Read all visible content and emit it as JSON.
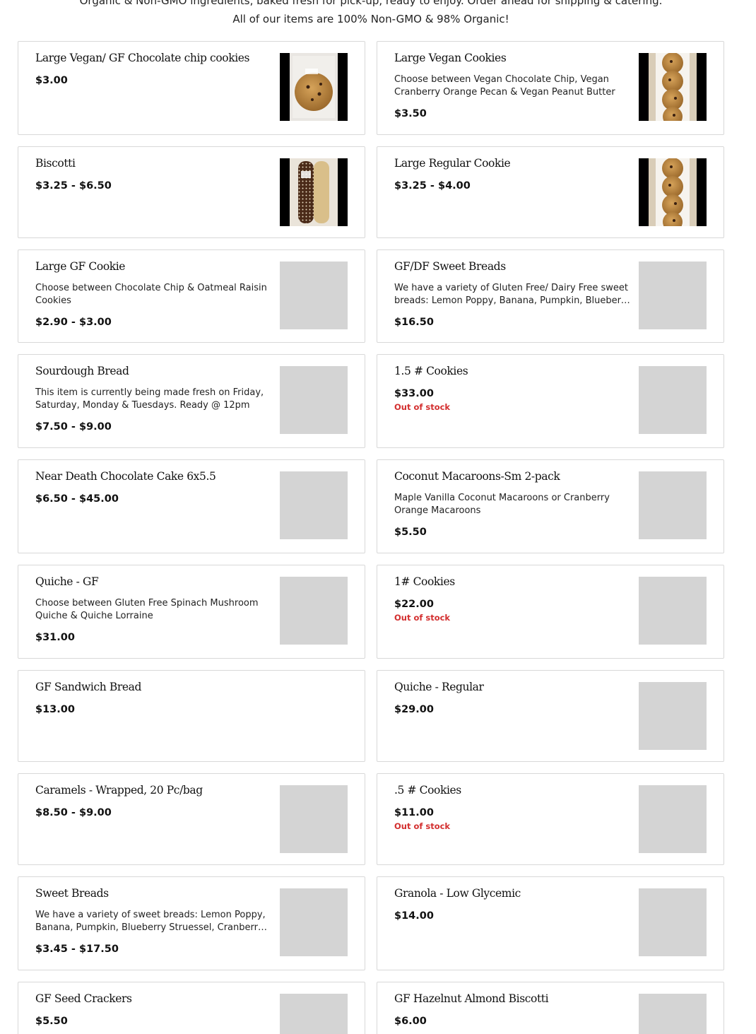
{
  "intro": {
    "line1": "Organic & Non-GMO ingredients, baked fresh for pick-up, ready to enjoy. Order ahead for shipping & catering.",
    "line2": "All of our items are 100% Non-GMO & 98% Organic!"
  },
  "products": [
    {
      "name": "Large Vegan/ GF Chocolate chip cookies",
      "desc": "",
      "price": "$3.00",
      "stock": "",
      "image": "photo-cookie-bag"
    },
    {
      "name": "Large Vegan Cookies",
      "desc": "Choose between Vegan Chocolate Chip, Vegan Cranberry Orange Pecan & Vegan Peanut Butter",
      "price": "$3.50",
      "stock": "",
      "image": "photo-cookie-platter"
    },
    {
      "name": "Biscotti",
      "desc": "",
      "price": "$3.25 - $6.50",
      "stock": "",
      "image": "photo-biscotti-bag"
    },
    {
      "name": "Large Regular Cookie",
      "desc": "",
      "price": "$3.25 - $4.00",
      "stock": "",
      "image": "photo-cookie-platter"
    },
    {
      "name": "Large GF Cookie",
      "desc": "Choose between Chocolate Chip & Oatmeal Raisin Cookies",
      "price": "$2.90 - $3.00",
      "stock": "",
      "image": "placeholder"
    },
    {
      "name": "GF/DF Sweet Breads",
      "desc": "We have a variety of Gluten Free/ Dairy Free sweet breads: Lemon Poppy, Banana, Pumpkin, Blueberry Struessel, Cranberry Orange",
      "price": "$16.50",
      "stock": "",
      "image": "placeholder"
    },
    {
      "name": "Sourdough Bread",
      "desc": "This item is currently being made fresh on Friday, Saturday, Monday & Tuesdays. Ready @ 12pm",
      "price": "$7.50 - $9.00",
      "stock": "",
      "image": "placeholder"
    },
    {
      "name": "1.5 # Cookies",
      "desc": "",
      "price": "$33.00",
      "stock": "Out of stock",
      "image": "placeholder"
    },
    {
      "name": "Near Death Chocolate Cake 6x5.5",
      "desc": "",
      "price": "$6.50 - $45.00",
      "stock": "",
      "image": "placeholder"
    },
    {
      "name": "Coconut Macaroons-Sm 2-pack",
      "desc": "Maple Vanilla Coconut Macaroons or Cranberry Orange Macaroons",
      "price": "$5.50",
      "stock": "",
      "image": "placeholder"
    },
    {
      "name": "Quiche - GF",
      "desc": "Choose between Gluten Free Spinach Mushroom Quiche & Quiche Lorraine",
      "price": "$31.00",
      "stock": "",
      "image": "placeholder"
    },
    {
      "name": "1# Cookies",
      "desc": "",
      "price": "$22.00",
      "stock": "Out of stock",
      "image": "placeholder"
    },
    {
      "name": "GF Sandwich Bread",
      "desc": "",
      "price": "$13.00",
      "stock": "",
      "image": "none"
    },
    {
      "name": "Quiche - Regular",
      "desc": "",
      "price": "$29.00",
      "stock": "",
      "image": "placeholder"
    },
    {
      "name": "Caramels - Wrapped, 20 Pc/bag",
      "desc": "",
      "price": "$8.50 - $9.00",
      "stock": "",
      "image": "placeholder"
    },
    {
      "name": ".5 # Cookies",
      "desc": "",
      "price": "$11.00",
      "stock": "Out of stock",
      "image": "placeholder"
    },
    {
      "name": "Sweet Breads",
      "desc": "We have a variety of sweet breads: Lemon Poppy, Banana, Pumpkin, Blueberry Struessel, Cranberry Orange",
      "price": "$3.45 - $17.50",
      "stock": "",
      "image": "placeholder"
    },
    {
      "name": "Granola - Low Glycemic",
      "desc": "",
      "price": "$14.00",
      "stock": "",
      "image": "placeholder"
    },
    {
      "name": "GF Seed Crackers",
      "desc": "",
      "price": "$5.50",
      "stock": "",
      "image": "placeholder"
    },
    {
      "name": "GF Hazelnut Almond Biscotti",
      "desc": "",
      "price": "$6.00",
      "stock": "",
      "image": "placeholder"
    }
  ],
  "colors": {
    "out_of_stock": "#d32f2f",
    "placeholder": "#d4d4d4",
    "border": "#d8d8d8"
  }
}
